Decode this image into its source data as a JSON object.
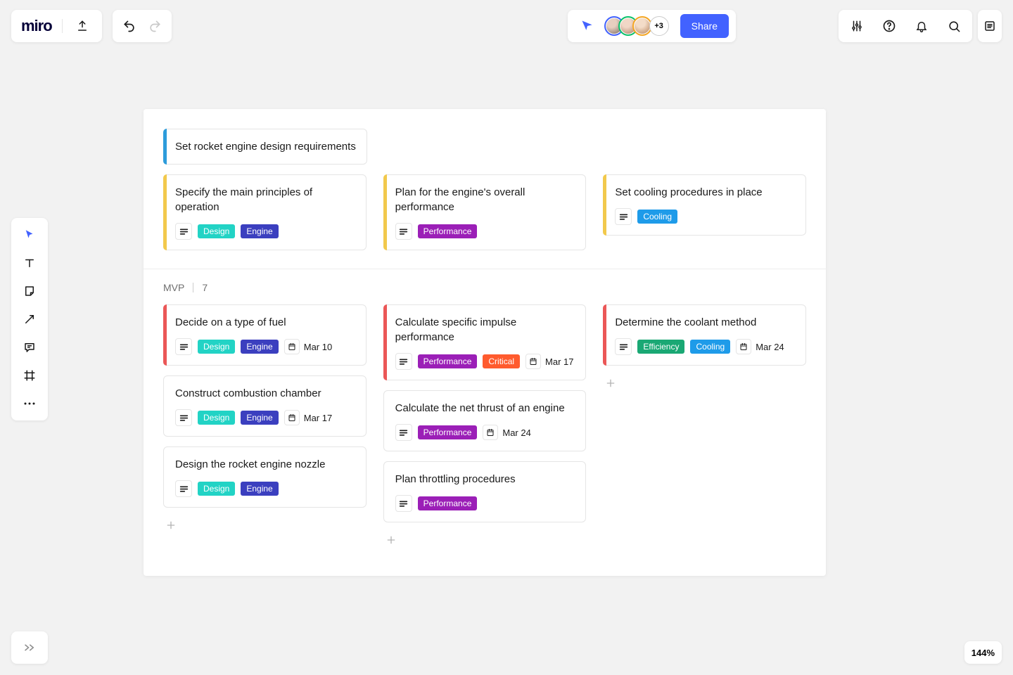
{
  "brand": {
    "name": "miro"
  },
  "header": {
    "share_label": "Share",
    "more_avatars": "+3"
  },
  "zoom": {
    "level": "144%"
  },
  "colors": {
    "blueAccent": "#2d9cdb",
    "yellowAccent": "#f2c94c",
    "redAccent": "#eb5757",
    "tag_design": "#22d3c5",
    "tag_engine": "#3b3fbf",
    "tag_performance": "#9b1fb7",
    "tag_critical": "#ff5b2e",
    "tag_efficiency": "#1aa874",
    "tag_cooling": "#1e9be9"
  },
  "section1": {
    "header_card": {
      "title": "Set rocket engine design requirements"
    },
    "columns": [
      [
        {
          "title": "Specify the main principles of operation",
          "tags": [
            {
              "text": "Design",
              "colorKey": "tag_design"
            },
            {
              "text": "Engine",
              "colorKey": "tag_engine"
            }
          ]
        }
      ],
      [
        {
          "title": "Plan for the engine's overall performance",
          "tags": [
            {
              "text": "Performance",
              "colorKey": "tag_performance"
            }
          ]
        }
      ],
      [
        {
          "title": "Set cooling procedures in place",
          "tags": [
            {
              "text": "Cooling",
              "colorKey": "tag_cooling"
            }
          ]
        }
      ]
    ]
  },
  "section2": {
    "name": "MVP",
    "count": "7",
    "columns": [
      [
        {
          "title": "Decide on a type of fuel",
          "accent": "redAccent",
          "tags": [
            {
              "text": "Design",
              "colorKey": "tag_design"
            },
            {
              "text": "Engine",
              "colorKey": "tag_engine"
            }
          ],
          "date": "Mar 10"
        },
        {
          "title": "Construct combustion chamber",
          "tags": [
            {
              "text": "Design",
              "colorKey": "tag_design"
            },
            {
              "text": "Engine",
              "colorKey": "tag_engine"
            }
          ],
          "date": "Mar 17"
        },
        {
          "title": "Design the rocket engine nozzle",
          "tags": [
            {
              "text": "Design",
              "colorKey": "tag_design"
            },
            {
              "text": "Engine",
              "colorKey": "tag_engine"
            }
          ]
        }
      ],
      [
        {
          "title": "Calculate specific impulse performance",
          "accent": "redAccent",
          "tags": [
            {
              "text": "Performance",
              "colorKey": "tag_performance"
            },
            {
              "text": "Critical",
              "colorKey": "tag_critical"
            }
          ],
          "date": "Mar 17"
        },
        {
          "title": "Calculate the net thrust of an engine",
          "tags": [
            {
              "text": "Performance",
              "colorKey": "tag_performance"
            }
          ],
          "date": "Mar 24"
        },
        {
          "title": "Plan throttling procedures",
          "tags": [
            {
              "text": "Performance",
              "colorKey": "tag_performance"
            }
          ]
        }
      ],
      [
        {
          "title": "Determine the coolant method",
          "accent": "redAccent",
          "tags": [
            {
              "text": "Efficiency",
              "colorKey": "tag_efficiency"
            },
            {
              "text": "Cooling",
              "colorKey": "tag_cooling"
            }
          ],
          "date": "Mar 24"
        }
      ]
    ]
  }
}
